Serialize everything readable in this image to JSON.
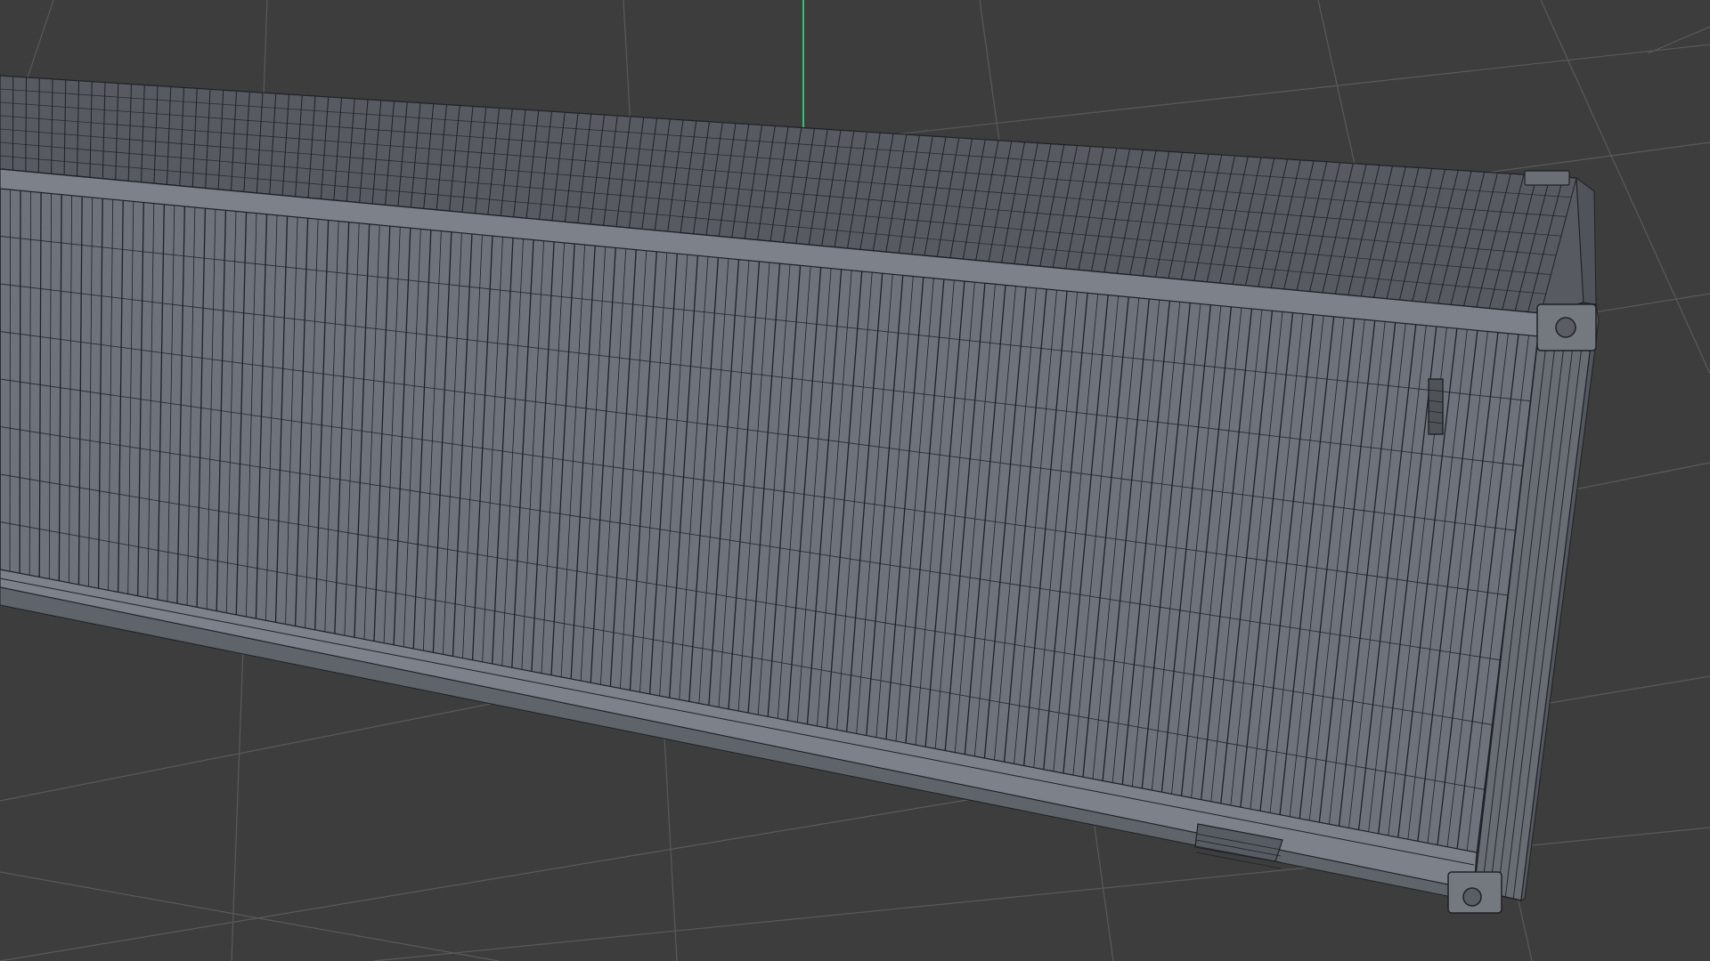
{
  "viewport": {
    "background_color": "#3d3d3d",
    "grid_color": "#5a5a5a",
    "y_axis_color": "#35c07a",
    "wire_color": "#1e2126",
    "side_face_color": "#6e737b",
    "roof_color": "#575b61",
    "rail_color": "#7d8189",
    "end_frame_color": "#686c73"
  },
  "scene": {
    "object": "shipping-container",
    "shading_mode": "wireframe-on-shaded",
    "grid_visible": true,
    "axis_visible": "y"
  }
}
